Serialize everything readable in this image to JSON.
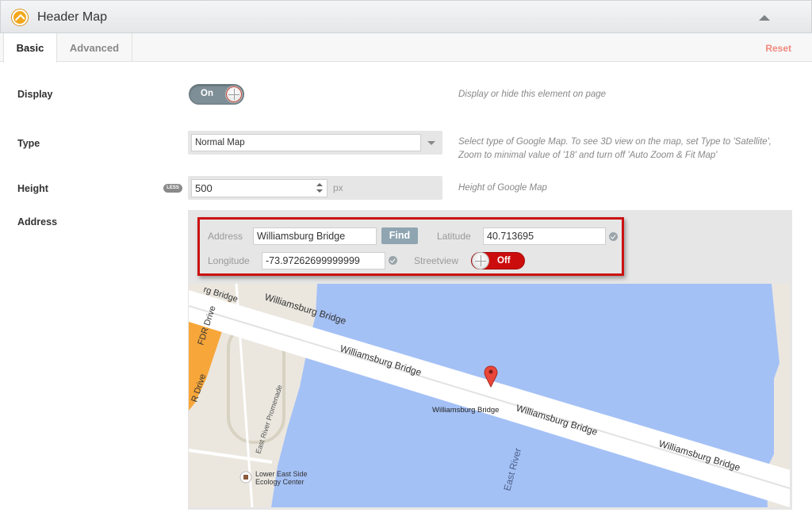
{
  "panel": {
    "title": "Header Map"
  },
  "tabs": [
    {
      "label": "Basic"
    },
    {
      "label": "Advanced"
    }
  ],
  "reset_label": "Reset",
  "fields": {
    "display": {
      "label": "Display",
      "toggle": "On",
      "hint": "Display or hide this element on page"
    },
    "type": {
      "label": "Type",
      "value": "Normal Map",
      "hint_line1": "Select type of Google Map. To see 3D view on the map, set Type to 'Satellite',",
      "hint_line2": "Zoom to minimal value of '18' and turn off 'Auto Zoom & Fit Map'"
    },
    "height": {
      "label": "Height",
      "badge": "LESS",
      "value": "500",
      "unit": "px",
      "hint": "Height of Google Map"
    },
    "address": {
      "label": "Address",
      "address_label": "Address",
      "address_value": "Williamsburg Bridge",
      "find_label": "Find",
      "latitude_label": "Latitude",
      "latitude_value": "40.713695",
      "longitude_label": "Longitude",
      "longitude_value": "-73.97262699999999",
      "streetview_label": "Streetview",
      "streetview_toggle": "Off"
    }
  },
  "map": {
    "labels": {
      "bridge_top_partial": "rg Bridge",
      "bridge_1": "Williamsburg Bridge",
      "bridge_2": "Williamsburg Bridge",
      "bridge_3": "Williamsburg Bridge",
      "bridge_4": "Williamsburg Bridge",
      "marker_label": "Williamsburg Bridge",
      "fdr_1": "FDR Drive",
      "fdr_2": "R Drive",
      "promenade": "East River Promenade",
      "east_river": "East River",
      "poi_line1": "Lower East Side",
      "poi_line2": "Ecology Center"
    },
    "colors": {
      "water": "#a4c1f6",
      "land": "#ebe7df",
      "road": "#ffffff",
      "highway": "#f7a63a",
      "marker": "#e9463a"
    }
  }
}
